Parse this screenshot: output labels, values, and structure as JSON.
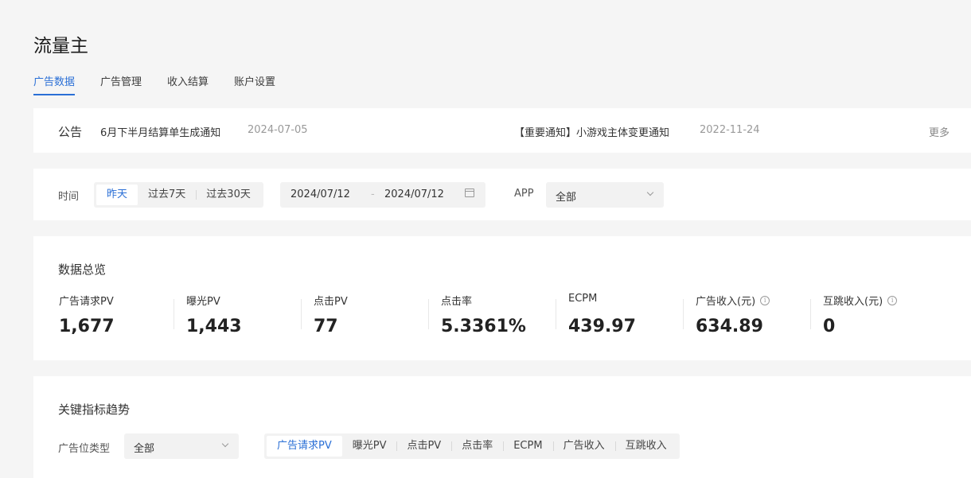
{
  "page_title": "流量主",
  "tabs": [
    {
      "label": "广告数据",
      "active": true
    },
    {
      "label": "广告管理"
    },
    {
      "label": "收入结算"
    },
    {
      "label": "账户设置"
    }
  ],
  "notice": {
    "label": "公告",
    "items": [
      {
        "title": "6月下半月结算单生成通知",
        "date": "2024-07-05"
      },
      {
        "title": "【重要通知】小游戏主体变更通知",
        "date": "2022-11-24"
      }
    ],
    "more": "更多"
  },
  "filter": {
    "time_label": "时间",
    "time_options": [
      "昨天",
      "过去7天",
      "过去30天"
    ],
    "start_date": "2024/07/12",
    "separator": "-",
    "end_date": "2024/07/12",
    "app_label": "APP",
    "app_value": "全部"
  },
  "overview": {
    "title": "数据总览",
    "metrics": [
      {
        "label": "广告请求PV",
        "value": "1,677"
      },
      {
        "label": "曝光PV",
        "value": "1,443"
      },
      {
        "label": "点击PV",
        "value": "77"
      },
      {
        "label": "点击率",
        "value": "5.3361%"
      },
      {
        "label": "ECPM",
        "value": "439.97"
      },
      {
        "label": "广告收入(元)",
        "value": "634.89",
        "info": "i"
      },
      {
        "label": "互跳收入(元)",
        "value": "0",
        "info": "i"
      }
    ]
  },
  "trend": {
    "title": "关键指标趋势",
    "slot_label": "广告位类型",
    "slot_value": "全部",
    "metric_options": [
      "广告请求PV",
      "曝光PV",
      "点击PV",
      "点击率",
      "ECPM",
      "广告收入",
      "互跳收入"
    ]
  },
  "colors": {
    "accent": "#2a6fd6",
    "background": "#f5f5f5",
    "card": "#ffffff"
  }
}
